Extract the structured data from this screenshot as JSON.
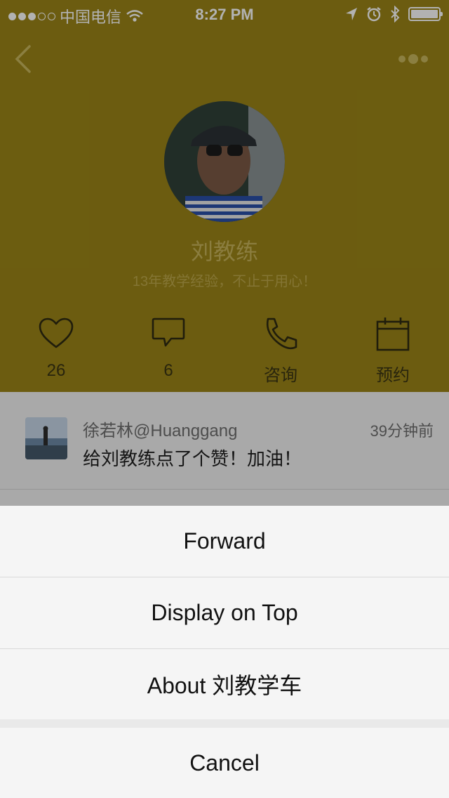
{
  "status_bar": {
    "carrier": "中国电信",
    "time": "8:27 PM",
    "signal_filled": 3,
    "signal_total": 5,
    "icons": [
      "wifi-icon",
      "location-arrow-icon",
      "alarm-icon",
      "bluetooth-icon",
      "battery-icon"
    ]
  },
  "profile": {
    "name": "刘教练",
    "bio": "13年教学经验，不止于用心！"
  },
  "stats": [
    {
      "icon": "heart-icon",
      "label": "26"
    },
    {
      "icon": "comment-icon",
      "label": "6"
    },
    {
      "icon": "phone-icon",
      "label": "咨询"
    },
    {
      "icon": "calendar-icon",
      "label": "预约"
    }
  ],
  "feed": [
    {
      "user": "徐若林@Huanggang",
      "time": "39分钟前",
      "text": "给刘教练点了个赞！加油！"
    }
  ],
  "action_sheet": {
    "forward": "Forward",
    "display_on_top": "Display on Top",
    "about": "About 刘教学车",
    "cancel": "Cancel"
  },
  "colors": {
    "header_bg": "#9b8517",
    "name_color": "#c7b45b",
    "sheet_bg": "#f5f5f5"
  }
}
